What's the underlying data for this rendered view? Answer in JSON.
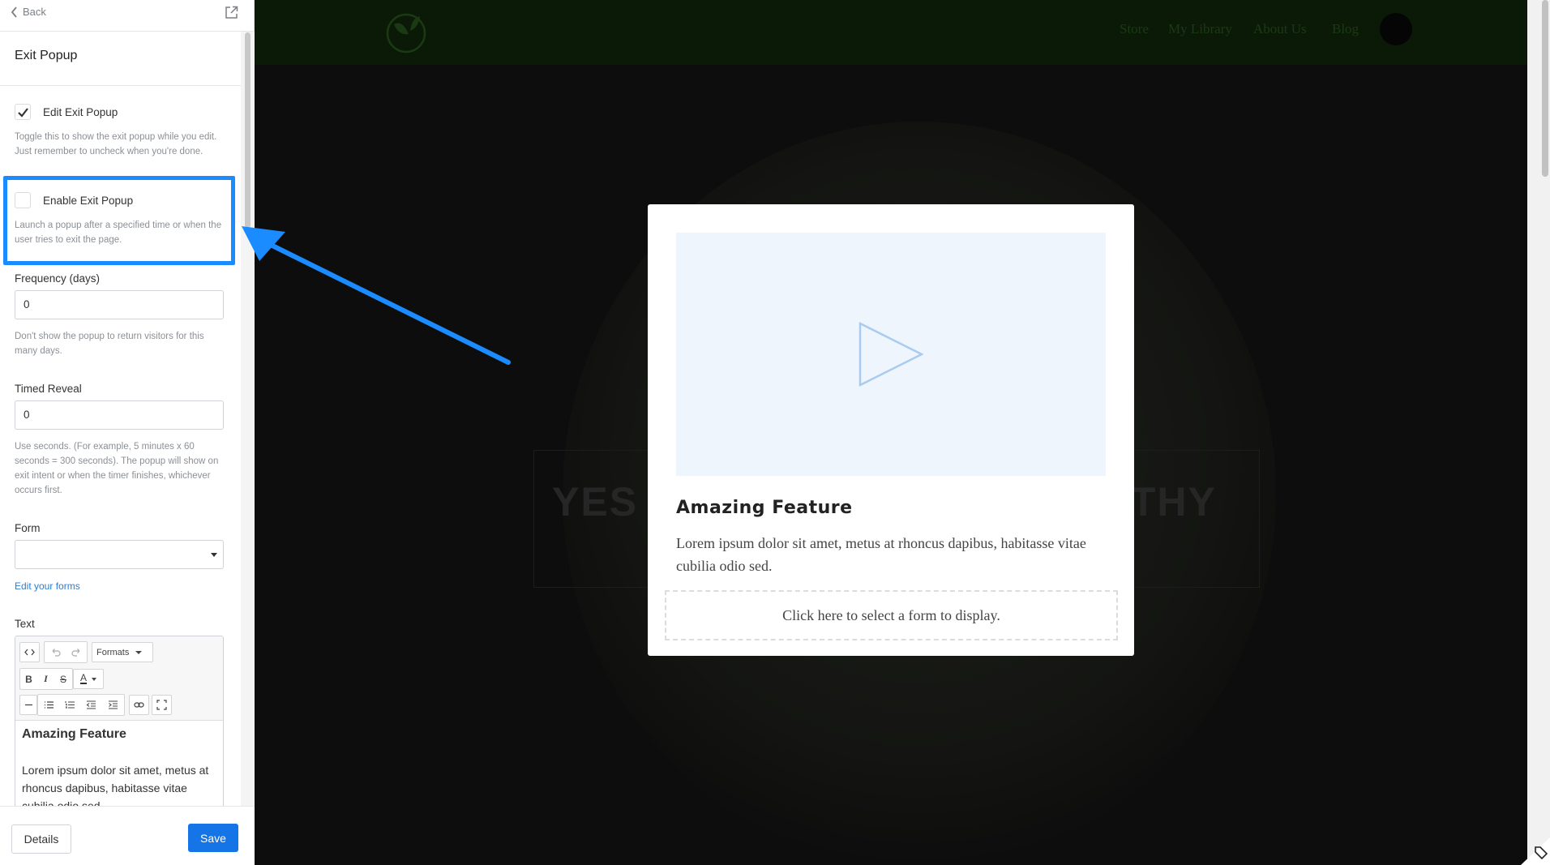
{
  "panel": {
    "back_label": "Back",
    "title": "Exit Popup",
    "edit_exit_popup": {
      "label": "Edit Exit Popup",
      "checked": true,
      "help": "Toggle this to show the exit popup while you edit. Just remember to uncheck when you're done."
    },
    "enable_exit_popup": {
      "label": "Enable Exit Popup",
      "checked": false,
      "help": "Launch a popup after a specified time or when the user tries to exit the page."
    },
    "frequency": {
      "label": "Frequency (days)",
      "value": "0",
      "help": "Don't show the popup to return visitors for this many days."
    },
    "timed_reveal": {
      "label": "Timed Reveal",
      "value": "0",
      "help": "Use seconds. (For example, 5 minutes x 60 seconds = 300 seconds). The popup will show on exit intent or when the timer finishes, whichever occurs first."
    },
    "form": {
      "label": "Form",
      "value": "",
      "edit_link": "Edit your forms"
    },
    "text": {
      "label": "Text",
      "formats_label": "Formats",
      "content_heading": "Amazing Feature",
      "content_paragraph": "Lorem ipsum dolor sit amet, metus at rhoncus dapibus, habitasse vitae cubilia odio sed."
    },
    "details_label": "Details",
    "save_label": "Save"
  },
  "site": {
    "nav_links": [
      "Store",
      "My Library",
      "About Us",
      "Blog"
    ],
    "hero_text_left": "YES I",
    "hero_text_right": "LTHY"
  },
  "modal": {
    "title": "Amazing Feature",
    "text": "Lorem ipsum dolor sit amet, metus at rhoncus dapibus, habitasse vitae cubilia odio sed.",
    "form_placeholder": "Click here to select a form to display."
  },
  "colors": {
    "accent": "#1a8cff",
    "save_button": "#1574e6",
    "link": "#2a7ed4",
    "video_placeholder": "#eef5fd"
  }
}
